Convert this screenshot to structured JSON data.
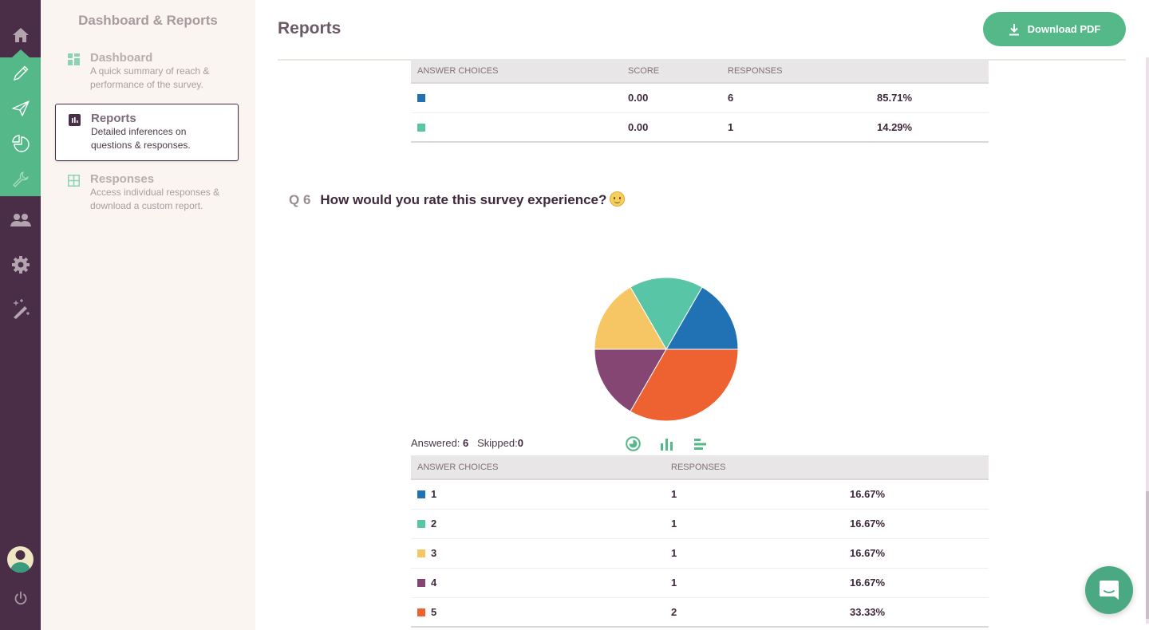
{
  "rail": {
    "items": [
      {
        "name": "home",
        "icon": "home-icon"
      },
      {
        "name": "edit",
        "icon": "pencil-icon"
      },
      {
        "name": "distribute",
        "icon": "send-icon"
      },
      {
        "name": "analytics",
        "icon": "pie-chart-icon"
      },
      {
        "name": "tools",
        "icon": "wrench-icon"
      },
      {
        "name": "users",
        "icon": "users-icon"
      },
      {
        "name": "settings",
        "icon": "gear-icon"
      },
      {
        "name": "magic",
        "icon": "magic-wand-icon"
      }
    ],
    "avatar_icon": "user-avatar-icon",
    "logout_icon": "power-icon"
  },
  "subnav": {
    "title": "Dashboard & Reports",
    "items": [
      {
        "label": "Dashboard",
        "desc": "A quick summary of reach & performance of the survey.",
        "icon": "dashboard-grid-icon",
        "active": false
      },
      {
        "label": "Reports",
        "desc": "Detailed inferences on questions & responses.",
        "icon": "bar-chart-icon",
        "active": true
      },
      {
        "label": "Responses",
        "desc": "Access individual responses & download a custom report.",
        "icon": "table-grid-icon",
        "active": false
      }
    ]
  },
  "header": {
    "title": "Reports",
    "download_label": "Download PDF"
  },
  "prev_table": {
    "headers": [
      "ANSWER CHOICES",
      "SCORE",
      "RESPONSES",
      ""
    ],
    "rows": [
      {
        "color": "#2172b4",
        "choice": "",
        "score": "0.00",
        "responses": "6",
        "percent": "85.71%"
      },
      {
        "color": "#57c5a6",
        "choice": "",
        "score": "0.00",
        "responses": "1",
        "percent": "14.29%"
      }
    ]
  },
  "question": {
    "number": "Q 6",
    "text": "How would you rate this survey experience?",
    "emoji": "smiling-face-emoji",
    "answered_label": "Answered:",
    "answered": "6",
    "skipped_label": "Skipped:",
    "skipped": "0",
    "view_toggles": [
      "pie-view-icon",
      "bar-view-icon",
      "horizontal-bar-view-icon"
    ]
  },
  "q6_table": {
    "headers": [
      "ANSWER CHOICES",
      "RESPONSES",
      ""
    ],
    "rows": [
      {
        "color": "#2172b4",
        "choice": "1",
        "responses": "1",
        "percent": "16.67%"
      },
      {
        "color": "#57c5a6",
        "choice": "2",
        "responses": "1",
        "percent": "16.67%"
      },
      {
        "color": "#f7c664",
        "choice": "3",
        "responses": "1",
        "percent": "16.67%"
      },
      {
        "color": "#864674",
        "choice": "4",
        "responses": "1",
        "percent": "16.67%"
      },
      {
        "color": "#ee6130",
        "choice": "5",
        "responses": "2",
        "percent": "33.33%"
      }
    ]
  },
  "chart_data": {
    "type": "pie",
    "title": "How would you rate this survey experience?",
    "categories": [
      "1",
      "2",
      "3",
      "4",
      "5"
    ],
    "values": [
      1,
      1,
      1,
      1,
      2
    ],
    "percentages": [
      16.67,
      16.67,
      16.67,
      16.67,
      33.33
    ],
    "colors": [
      "#2172b4",
      "#57c5a6",
      "#f7c664",
      "#864674",
      "#ee6130"
    ],
    "legend": "none"
  },
  "chat": {
    "icon": "chat-bubble-icon"
  },
  "colors": {
    "brand_green": "#55b889",
    "rail_purple": "#4a2e47"
  }
}
